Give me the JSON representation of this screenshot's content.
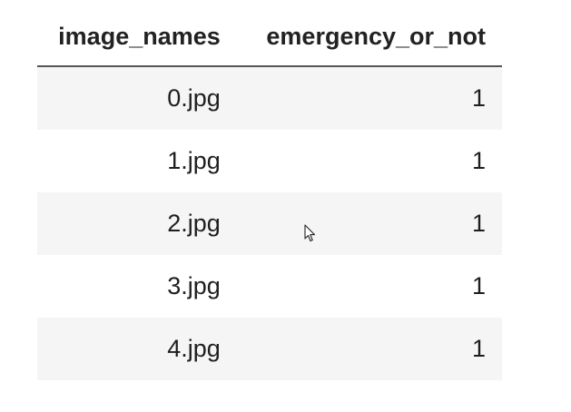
{
  "table": {
    "columns": [
      "image_names",
      "emergency_or_not"
    ],
    "rows": [
      {
        "image_names": "0.jpg",
        "emergency_or_not": "1"
      },
      {
        "image_names": "1.jpg",
        "emergency_or_not": "1"
      },
      {
        "image_names": "2.jpg",
        "emergency_or_not": "1"
      },
      {
        "image_names": "3.jpg",
        "emergency_or_not": "1"
      },
      {
        "image_names": "4.jpg",
        "emergency_or_not": "1"
      }
    ]
  },
  "colors": {
    "stripe": "#f5f5f5",
    "header_rule": "#555555",
    "text": "#1e1e1e"
  },
  "icons": {
    "cursor": "mouse-pointer-icon"
  }
}
